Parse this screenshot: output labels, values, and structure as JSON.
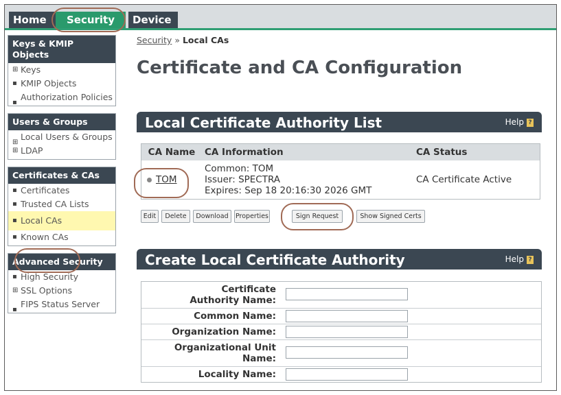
{
  "tabs": {
    "home": "Home",
    "security": "Security",
    "device": "Device"
  },
  "sidebar": {
    "sections": [
      {
        "title": "Keys & KMIP Objects",
        "items": [
          {
            "bullet": "⊞",
            "label": "Keys"
          },
          {
            "bullet": "▪",
            "label": "KMIP Objects"
          },
          {
            "bullet": "▪",
            "label": "Authorization Policies"
          }
        ]
      },
      {
        "title": "Users & Groups",
        "items": [
          {
            "bullet": "⊞",
            "label": "Local Users & Groups"
          },
          {
            "bullet": "⊞",
            "label": "LDAP"
          }
        ]
      },
      {
        "title": "Certificates & CAs",
        "items": [
          {
            "bullet": "▪",
            "label": "Certificates"
          },
          {
            "bullet": "▪",
            "label": "Trusted CA Lists"
          },
          {
            "bullet": "▪",
            "label": "Local CAs"
          },
          {
            "bullet": "▪",
            "label": "Known CAs"
          }
        ]
      },
      {
        "title": "Advanced Security",
        "items": [
          {
            "bullet": "▪",
            "label": "High Security"
          },
          {
            "bullet": "⊞",
            "label": "SSL Options"
          },
          {
            "bullet": "▪",
            "label": "FIPS Status Server"
          }
        ]
      }
    ]
  },
  "breadcrumb": {
    "parent": "Security",
    "separator": "»",
    "current": "Local CAs"
  },
  "page_title": "Certificate and CA Configuration",
  "ca_list": {
    "title": "Local Certificate Authority List",
    "help": "Help",
    "columns": [
      "CA Name",
      "CA Information",
      "CA Status"
    ],
    "rows": [
      {
        "name": "TOM",
        "info_common": "Common: TOM",
        "info_issuer": "Issuer: SPECTRA",
        "info_expires": "Expires: Sep 18 20:16:30 2026 GMT",
        "status": "CA Certificate Active"
      }
    ],
    "buttons": [
      "Edit",
      "Delete",
      "Download",
      "Properties",
      "Sign Request",
      "Show Signed Certs"
    ]
  },
  "create_ca": {
    "title": "Create Local Certificate Authority",
    "help": "Help",
    "fields": [
      {
        "label": "Certificate Authority Name:",
        "value": ""
      },
      {
        "label": "Common Name:",
        "value": ""
      },
      {
        "label": "Organization Name:",
        "value": ""
      },
      {
        "label": "Organizational Unit Name:",
        "value": ""
      },
      {
        "label": "Locality Name:",
        "value": ""
      }
    ]
  },
  "colors": {
    "tab_dark": "#3b4752",
    "tab_active": "#2a9a6c",
    "highlight": "#fff8b0",
    "annotation_circle": "#a06a55"
  }
}
